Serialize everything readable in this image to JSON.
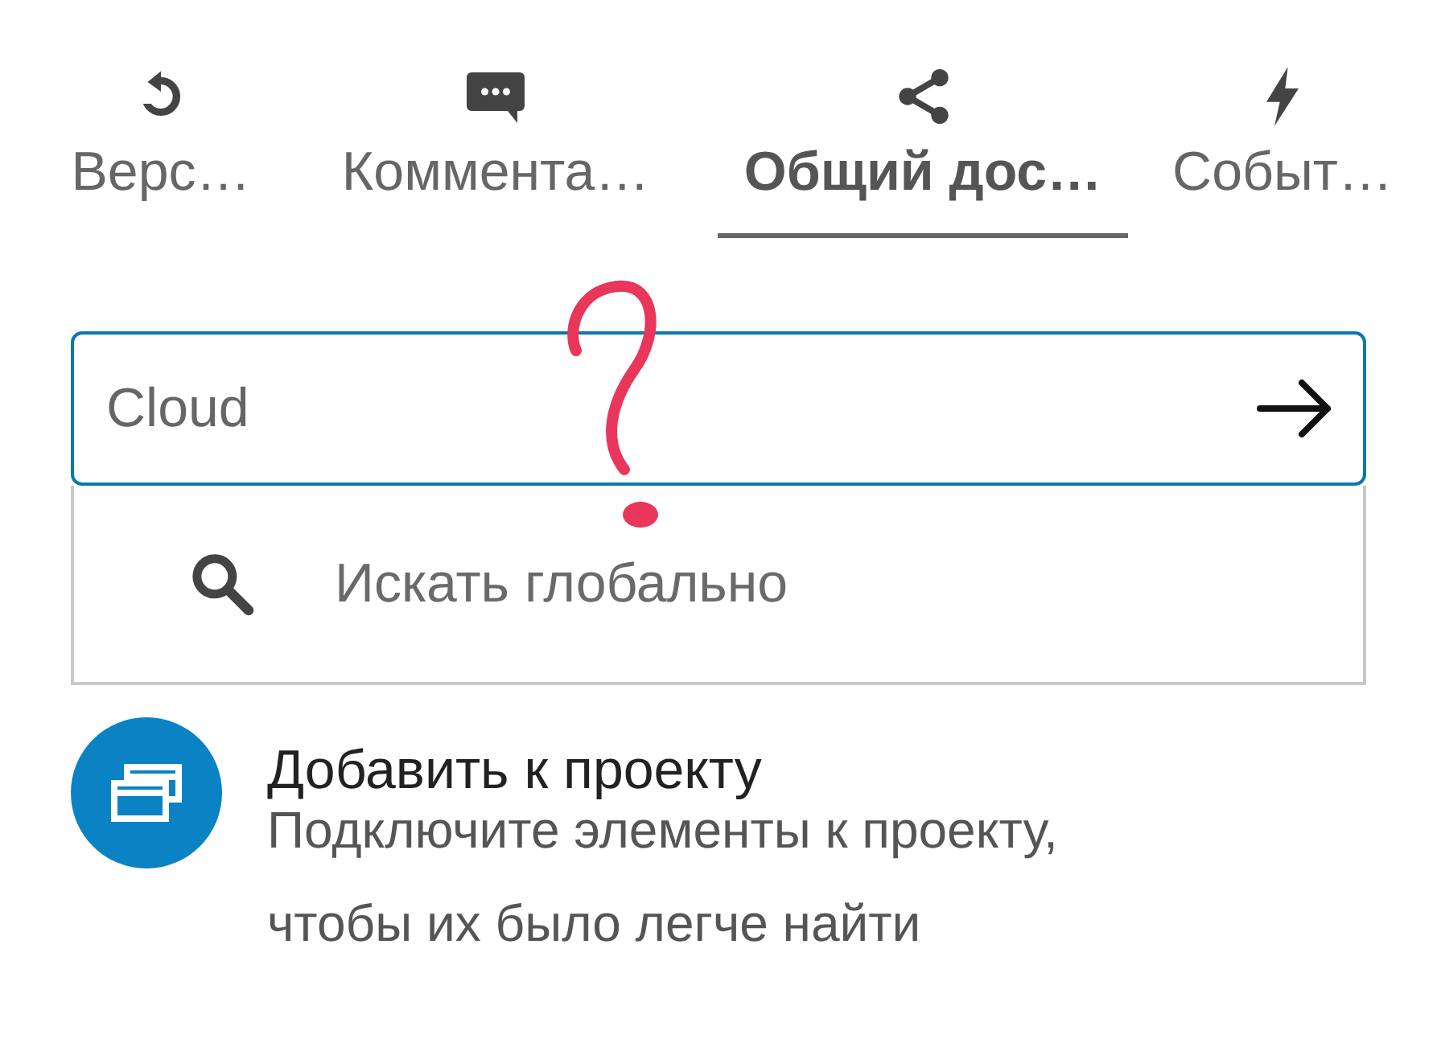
{
  "tabs": [
    {
      "label": "Верс…",
      "kind": "history",
      "selected": false
    },
    {
      "label": "Коммента…",
      "kind": "comment",
      "selected": false
    },
    {
      "label": "Общий дос…",
      "kind": "share",
      "selected": true
    },
    {
      "label": "Событ…",
      "kind": "bolt",
      "selected": false
    }
  ],
  "search": {
    "value": "Cloud"
  },
  "suggestion": {
    "label": "Искать глобально"
  },
  "project": {
    "title": "Добавить к проекту",
    "description": "Подключите элементы к проекту, чтобы их было легче найти"
  }
}
